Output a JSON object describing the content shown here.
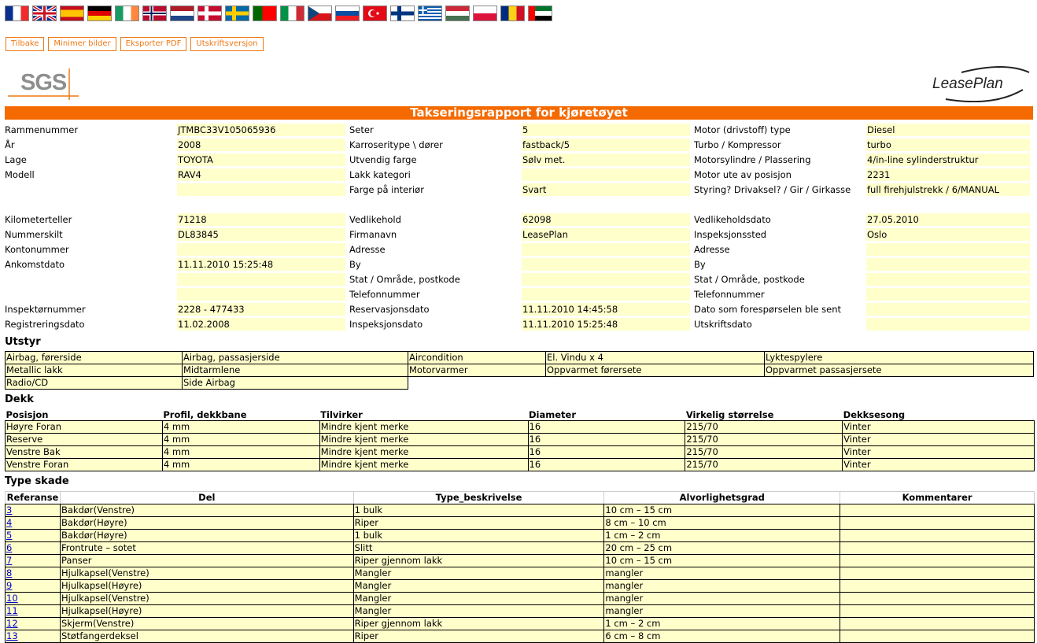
{
  "toolbar": {
    "back": "Tilbake",
    "minimize": "Minimer bilder",
    "export_pdf": "Eksporter PDF",
    "print": "Utskriftsversjon"
  },
  "flags": [
    {
      "name": "france-flag-icon",
      "type": "v",
      "colors": [
        "#0a2f8f",
        "#ffffff",
        "#ef2b2d"
      ]
    },
    {
      "name": "uk-flag-icon",
      "type": "uk",
      "colors": [
        "#0a2f8f",
        "#ffffff",
        "#cc1122"
      ]
    },
    {
      "name": "spain-flag-icon",
      "type": "h3",
      "colors": [
        "#c60b1e",
        "#ffc400",
        "#c60b1e"
      ],
      "ratio": [
        1,
        2,
        1
      ]
    },
    {
      "name": "germany-flag-icon",
      "type": "h3",
      "colors": [
        "#000000",
        "#dd0000",
        "#ffce00"
      ]
    },
    {
      "name": "ireland-flag-icon",
      "type": "v",
      "colors": [
        "#169b62",
        "#ffffff",
        "#ff883e"
      ]
    },
    {
      "name": "norway-flag-icon",
      "type": "cross",
      "colors": [
        "#ba0c2f",
        "#ffffff",
        "#00205b"
      ]
    },
    {
      "name": "netherlands-flag-icon",
      "type": "h3",
      "colors": [
        "#ae1c28",
        "#ffffff",
        "#21468b"
      ]
    },
    {
      "name": "denmark-flag-icon",
      "type": "cross",
      "colors": [
        "#c60c30",
        "#ffffff"
      ]
    },
    {
      "name": "sweden-flag-icon",
      "type": "cross",
      "colors": [
        "#006aa7",
        "#fecc00"
      ]
    },
    {
      "name": "portugal-flag-icon",
      "type": "v2",
      "colors": [
        "#006600",
        "#ff0000"
      ]
    },
    {
      "name": "italy-flag-icon",
      "type": "v",
      "colors": [
        "#009246",
        "#ffffff",
        "#ce2b37"
      ]
    },
    {
      "name": "czech-flag-icon",
      "type": "cz",
      "colors": [
        "#ffffff",
        "#d7141a",
        "#11457e"
      ]
    },
    {
      "name": "slovakia-flag-icon",
      "type": "h3",
      "colors": [
        "#ffffff",
        "#0b4ea2",
        "#ee1c25"
      ]
    },
    {
      "name": "turkey-flag-icon",
      "type": "solid",
      "colors": [
        "#e30a17"
      ]
    },
    {
      "name": "finland-flag-icon",
      "type": "cross",
      "colors": [
        "#ffffff",
        "#003580"
      ]
    },
    {
      "name": "greece-flag-icon",
      "type": "stripes",
      "colors": [
        "#0d5eaf",
        "#ffffff"
      ]
    },
    {
      "name": "hungary-flag-icon",
      "type": "h3",
      "colors": [
        "#ce2939",
        "#ffffff",
        "#477050"
      ]
    },
    {
      "name": "poland-flag-icon",
      "type": "h2",
      "colors": [
        "#ffffff",
        "#dc143c"
      ]
    },
    {
      "name": "romania-flag-icon",
      "type": "v",
      "colors": [
        "#002b7f",
        "#fcd116",
        "#ce1126"
      ]
    },
    {
      "name": "uae-flag-icon",
      "type": "uae",
      "colors": [
        "#ff0000",
        "#00732f",
        "#ffffff",
        "#000000"
      ]
    }
  ],
  "logos": {
    "sgs": "SGS",
    "leaseplan": "LeasePlan"
  },
  "report": {
    "title": "Takseringsrapport for kjøretøyet",
    "rows": [
      [
        "Rammenummer",
        "JTMBC33V105065936",
        "Seter",
        "5",
        "Motor (drivstoff) type",
        "Diesel"
      ],
      [
        "År",
        "2008",
        "Karroseritype \\ dører",
        "fastback/5",
        "Turbo / Kompressor",
        "turbo"
      ],
      [
        "Lage",
        "TOYOTA",
        "Utvendig farge",
        "Sølv met.",
        "Motorsylindre / Plassering",
        "4/in-line sylinderstruktur"
      ],
      [
        "Modell",
        "RAV4",
        "Lakk kategori",
        "",
        "Motor ute av posisjon",
        "2231"
      ],
      [
        "",
        "",
        "Farge på interiør",
        "Svart",
        "Styring? Drivaksel? / Gir / Girkasse",
        "full firehjulstrekk / 6/MANUAL"
      ],
      [
        "",
        "",
        "",
        "",
        "",
        ""
      ],
      [
        "Kilometerteller",
        "71218",
        "Vedlikehold",
        "62098",
        "Vedlikeholdsdato",
        "27.05.2010"
      ],
      [
        "Nummerskilt",
        "DL83845",
        "Firmanavn",
        "LeasePlan",
        "Inspeksjonssted",
        "Oslo"
      ],
      [
        "Kontonummer",
        "",
        "Adresse",
        "",
        "Adresse",
        ""
      ],
      [
        "Ankomstdato",
        "11.11.2010 15:25:48",
        "By",
        "",
        "By",
        ""
      ],
      [
        "",
        "",
        "Stat / Område, postkode",
        "",
        "Stat / Område, postkode",
        ""
      ],
      [
        "",
        "",
        "Telefonnummer",
        "",
        "Telefonnummer",
        ""
      ],
      [
        "Inspektørnummer",
        "2228 - 477433",
        "Reservasjonsdato",
        "11.11.2010 14:45:58",
        "Dato som forespørselen ble sent",
        ""
      ],
      [
        "Registreringsdato",
        "11.02.2008",
        "Inspeksjonsdato",
        "11.11.2010 15:25:48",
        "Utskriftsdato",
        ""
      ]
    ]
  },
  "equipment": {
    "title": "Utstyr",
    "rows": [
      [
        "Airbag, førerside",
        "Airbag, passasjerside",
        "Aircondition",
        "El. Vindu x 4",
        "Lyktespylere"
      ],
      [
        "Metallic lakk",
        "Midtarmlene",
        "Motorvarmer",
        "Oppvarmet førersete",
        "Oppvarmet passasjersete"
      ],
      [
        "Radio/CD",
        "Side Airbag"
      ]
    ]
  },
  "tires": {
    "title": "Dekk",
    "headers": [
      "Posisjon",
      "Profil, dekkbane",
      "Tilvirker",
      "Diameter",
      "Virkelig størrelse",
      "Dekksesong"
    ],
    "rows": [
      [
        "Høyre Foran",
        "4 mm",
        "Mindre kjent merke",
        "16",
        "215/70",
        "Vinter"
      ],
      [
        "Reserve",
        "4 mm",
        "Mindre kjent merke",
        "16",
        "215/70",
        "Vinter"
      ],
      [
        "Venstre Bak",
        "4 mm",
        "Mindre kjent merke",
        "16",
        "215/70",
        "Vinter"
      ],
      [
        "Venstre Foran",
        "4 mm",
        "Mindre kjent merke",
        "16",
        "215/70",
        "Vinter"
      ]
    ]
  },
  "damage": {
    "title": "Type skade",
    "headers": [
      "Referanse",
      "Del",
      "Type_beskrivelse",
      "Alvorlighetsgrad",
      "Kommentarer"
    ],
    "rows": [
      [
        "3",
        "Bakdør(Venstre)",
        "1 bulk",
        "10 cm – 15 cm",
        ""
      ],
      [
        "4",
        "Bakdør(Høyre)",
        "Riper",
        "8 cm – 10 cm",
        ""
      ],
      [
        "5",
        "Bakdør(Høyre)",
        "1 bulk",
        "1 cm – 2 cm",
        ""
      ],
      [
        "6",
        "Frontrute – sotet",
        "Slitt",
        "20 cm – 25 cm",
        ""
      ],
      [
        "7",
        "Panser",
        "Riper gjennom lakk",
        "10 cm – 15 cm",
        ""
      ],
      [
        "8",
        "Hjulkapsel(Venstre)",
        "Mangler",
        "mangler",
        ""
      ],
      [
        "9",
        "Hjulkapsel(Høyre)",
        "Mangler",
        "mangler",
        ""
      ],
      [
        "10",
        "Hjulkapsel(Venstre)",
        "Mangler",
        "mangler",
        ""
      ],
      [
        "11",
        "Hjulkapsel(Høyre)",
        "Mangler",
        "mangler",
        ""
      ],
      [
        "12",
        "Skjerm(Venstre)",
        "Riper gjennom lakk",
        "1 cm – 2 cm",
        ""
      ],
      [
        "13",
        "Støtfangerdeksel",
        "Riper",
        "6 cm – 8 cm",
        ""
      ]
    ]
  },
  "colors": {
    "accent": "#f56a00",
    "field_bg": "#ffffcc",
    "link": "#0000cc"
  }
}
